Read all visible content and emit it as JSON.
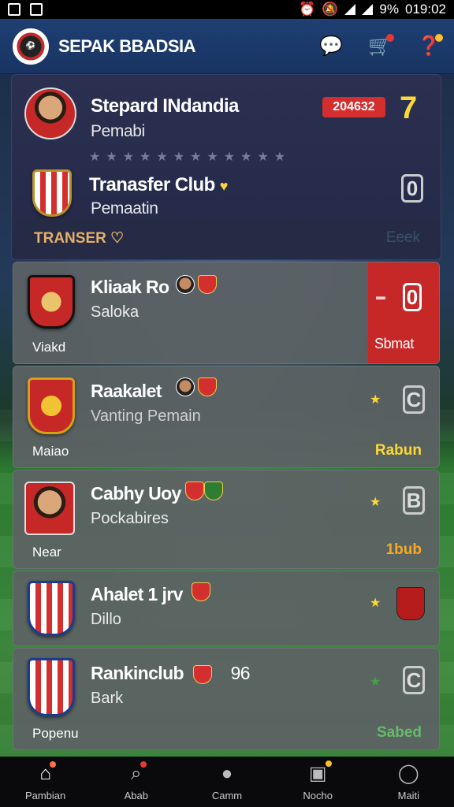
{
  "status_bar": {
    "battery": "9%",
    "time": "019:02"
  },
  "header": {
    "title": "SEPAK BBADSIA",
    "icons": [
      "chat-bubble-icon",
      "cart-icon",
      "help-icon"
    ]
  },
  "profile": {
    "name": "Stepard INdandia",
    "role": "Pemabi",
    "badge": "204632",
    "level": "7",
    "stars_total": 12,
    "club_title": "Tranasfer Club",
    "club_sub": "Pemaatin",
    "club_value": "0",
    "transfer_label": "TRANSER",
    "transfer_right": "Eeek"
  },
  "rows": [
    {
      "name": "Kliaak Ro",
      "sub": "Saloka",
      "foot": "Viakd",
      "value": "0",
      "side_label": "Sbmat",
      "right": ""
    },
    {
      "name": "Raakalet",
      "sub": "Vanting Pemain",
      "foot": "Maiao",
      "value": "C",
      "right": "Rabun"
    },
    {
      "name": "Cabhy Uoy",
      "sub": "Pockabires",
      "foot": "Near",
      "value": "B",
      "right": "1bub"
    },
    {
      "name": "Ahalet 1 jrv",
      "sub": "Dillo",
      "foot": "",
      "value": "",
      "right": ""
    },
    {
      "name": "Rankinclub",
      "num": "96",
      "sub": "Bark",
      "foot": "Popenu",
      "value": "C",
      "right": "Sabed"
    }
  ],
  "nav": [
    {
      "label": "Pambian",
      "icon": "home-icon"
    },
    {
      "label": "Abab",
      "icon": "search-icon"
    },
    {
      "label": "Camm",
      "icon": "chat-icon"
    },
    {
      "label": "Nocho",
      "icon": "clipboard-icon"
    },
    {
      "label": "Maiti",
      "icon": "user-icon"
    }
  ]
}
